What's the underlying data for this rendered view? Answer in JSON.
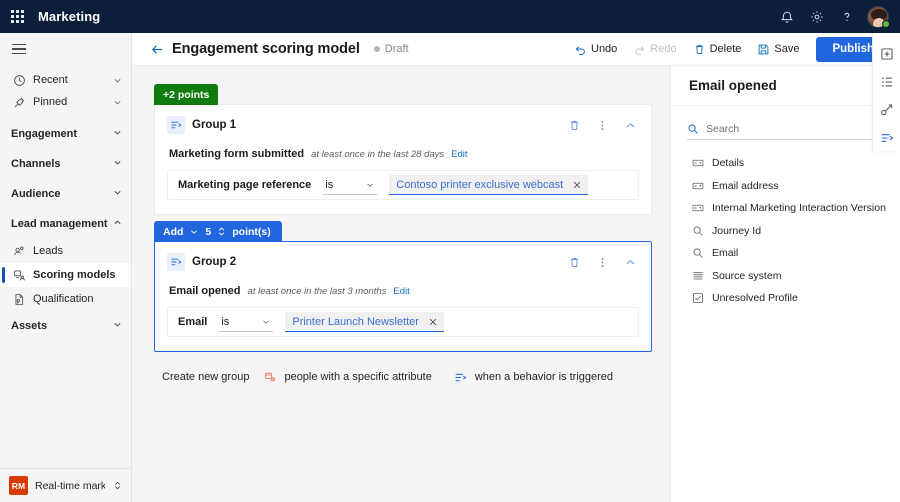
{
  "topbar": {
    "waffle_label": "app-launcher",
    "brand": "Marketing",
    "icons": [
      "notification-bell-icon",
      "settings-gear-icon",
      "help-question-icon",
      "user-avatar"
    ]
  },
  "sidebar": {
    "hamburger_label": "menu",
    "items": [
      {
        "label": "Recent",
        "icon": "clock-icon",
        "type": "row",
        "chevron": "down"
      },
      {
        "label": "Pinned",
        "icon": "pin-icon",
        "type": "row",
        "chevron": "down"
      },
      {
        "label": "Engagement",
        "type": "group",
        "chevron": "down"
      },
      {
        "label": "Channels",
        "type": "group",
        "chevron": "down"
      },
      {
        "label": "Audience",
        "type": "group",
        "chevron": "down"
      },
      {
        "label": "Lead management",
        "type": "group",
        "chevron": "up"
      },
      {
        "label": "Leads",
        "icon": "leads-icon",
        "type": "sub",
        "selected": false
      },
      {
        "label": "Scoring models",
        "icon": "scoring-icon",
        "type": "sub",
        "selected": true
      },
      {
        "label": "Qualification",
        "icon": "qualification-icon",
        "type": "sub",
        "selected": false
      },
      {
        "label": "Assets",
        "type": "group",
        "chevron": "down"
      }
    ],
    "env": {
      "initials": "RM",
      "name": "Real-time marketi..."
    }
  },
  "command_bar": {
    "back_label": "back-arrow",
    "title": "Engagement scoring model",
    "status": "Draft",
    "buttons": [
      {
        "label": "Undo",
        "icon": "undo-icon",
        "disabled": false
      },
      {
        "label": "Redo",
        "icon": "redo-icon",
        "disabled": true
      },
      {
        "label": "Delete",
        "icon": "trash-icon",
        "disabled": false
      },
      {
        "label": "Save",
        "icon": "save-icon",
        "disabled": false
      }
    ],
    "publish_label": "Publish"
  },
  "canvas": {
    "groups": [
      {
        "badge": {
          "text": "+2 points",
          "style": "green"
        },
        "title": "Group 1",
        "selected": false,
        "trigger": {
          "name": "Marketing form submitted",
          "frequency": "at least once in the last 28 days",
          "edit_label": "Edit"
        },
        "condition": {
          "attribute": "Marketing page reference",
          "operator": "is",
          "value": "Contoso printer exclusive webcast"
        }
      },
      {
        "badge": {
          "style": "blue",
          "action": "Add",
          "amount": "5",
          "unit": "point(s)"
        },
        "title": "Group 2",
        "selected": true,
        "trigger": {
          "name": "Email opened",
          "frequency": "at least once in the last 3 months",
          "edit_label": "Edit"
        },
        "condition": {
          "attribute": "Email",
          "operator": "is",
          "value": "Printer Launch Newsletter"
        }
      }
    ],
    "create_row": {
      "lead_label": "Create new group",
      "options": [
        {
          "label": "people with a specific attribute",
          "icon": "attribute-icon"
        },
        {
          "label": "when a behavior is triggered",
          "icon": "behavior-icon"
        }
      ]
    }
  },
  "right_panel": {
    "title": "Email opened",
    "pin_icon": "collapse-panel-icon",
    "search": {
      "placeholder": "Search",
      "value": ""
    },
    "items": [
      {
        "label": "Details",
        "icon": "text-field-icon"
      },
      {
        "label": "Email address",
        "icon": "text-field-icon"
      },
      {
        "label": "Internal Marketing Interaction Version",
        "icon": "text-field-icon"
      },
      {
        "label": "Journey Id",
        "icon": "lookup-icon"
      },
      {
        "label": "Email",
        "icon": "lookup-icon"
      },
      {
        "label": "Source system",
        "icon": "list-icon"
      },
      {
        "label": "Unresolved Profile",
        "icon": "checkbox-icon"
      }
    ]
  },
  "rail": {
    "buttons": [
      {
        "name": "add-panel-icon",
        "active": false
      },
      {
        "name": "list-panel-icon",
        "active": false
      },
      {
        "name": "conditions-panel-icon",
        "active": false
      },
      {
        "name": "trigger-panel-icon",
        "active": true
      }
    ]
  },
  "colors": {
    "brand_navy": "#0b1f3b",
    "accent_blue": "#2266dd",
    "link_blue": "#0f6cbd",
    "green_badge": "#107c10",
    "canvas_bg": "#f5f5f5",
    "env_orange": "#d83b01"
  }
}
